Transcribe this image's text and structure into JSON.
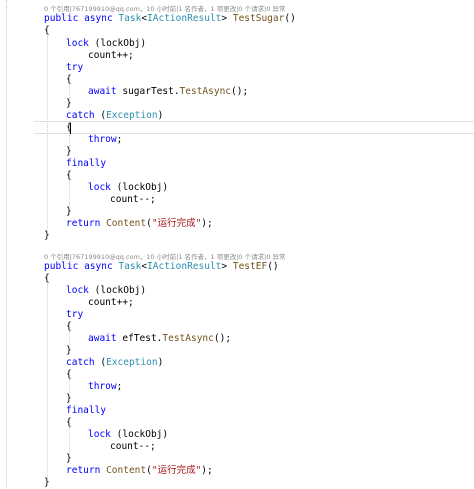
{
  "codelens": [
    "0 个引用|767199910@qq.com，10 小时前|1 名作者，1 项更改|0 个请求|0 异常",
    "0 个引用|767199910@qq.com，10 小时前|1 名作者，1 项更改|0 个请求|0 异常"
  ],
  "method1": {
    "sig_kw1": "public",
    "sig_kw2": "async",
    "sig_type1": "Task",
    "sig_lt": "<",
    "sig_type2": "IActionResult",
    "sig_gt": ">",
    "sig_name": "TestSugar",
    "sig_parens": "()",
    "open_brace": "{",
    "lock_kw": "lock",
    "lock_arg": "(lockObj)",
    "count_inc": "count++;",
    "try_kw": "try",
    "brace_open": "{",
    "brace_close": "}",
    "await_kw": "await",
    "await_obj": "sugarTest.",
    "await_meth": "TestAsync",
    "await_rest": "();",
    "catch_kw": "catch",
    "catch_open": "(",
    "catch_type": "Exception",
    "catch_close": ")",
    "throw_kw": "throw",
    "throw_semi": ";",
    "finally_kw": "finally",
    "count_dec": "count--;",
    "return_kw": "return",
    "return_meth": "Content",
    "return_open": "(",
    "return_str": "\"运行完成\"",
    "return_close": ");",
    "close_brace": "}"
  },
  "method2": {
    "sig_name": "TestEF",
    "await_obj": "efTest.",
    "await_meth": "TestAsync"
  }
}
